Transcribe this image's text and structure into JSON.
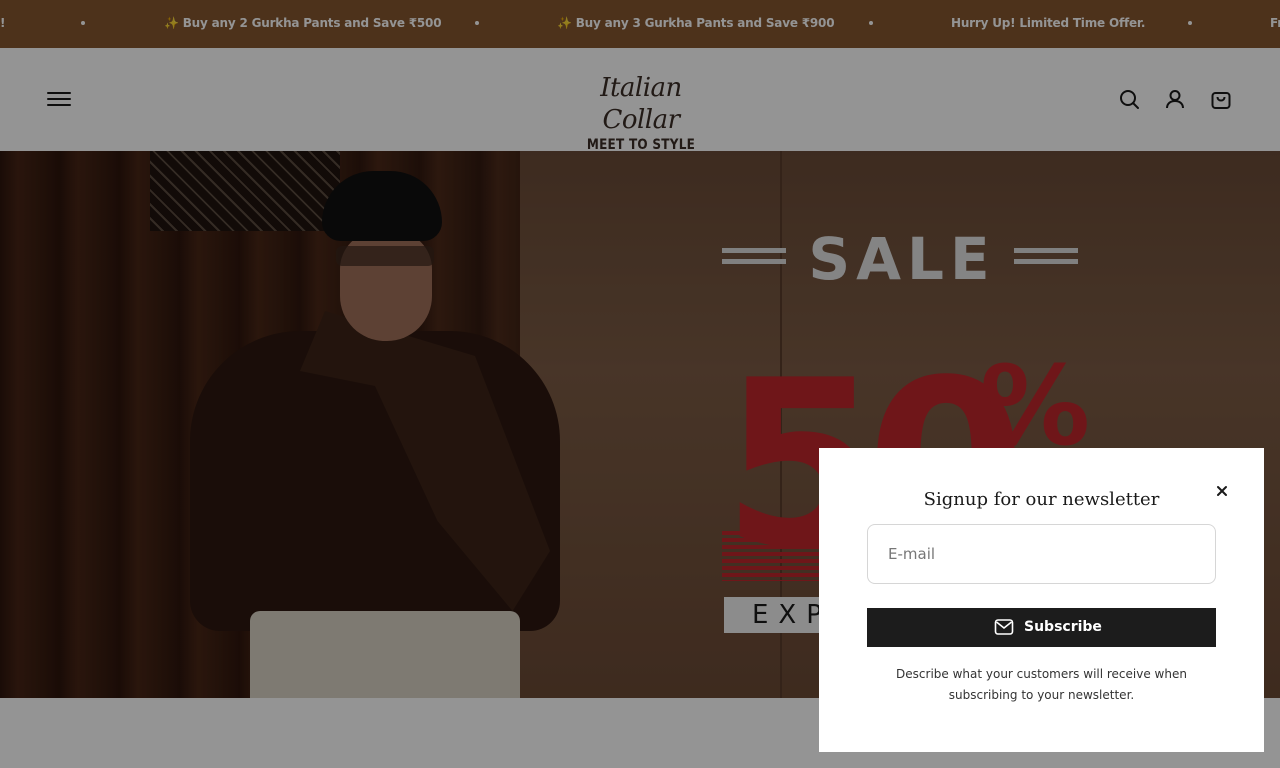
{
  "announcement": {
    "messages": [
      "!",
      "✨ Buy any 2 Gurkha Pants and Save ₹500",
      "✨ Buy any 3 Gurkha Pants and Save ₹900",
      "Hurry Up! Limited Time Offer.",
      "Fr"
    ],
    "background": "#85562f"
  },
  "header": {
    "logo_script": "Italian Collar",
    "logo_tagline": "MEET TO STYLE",
    "icons": [
      "menu-icon",
      "search-icon",
      "account-icon",
      "cart-icon"
    ]
  },
  "hero": {
    "sale_word": "SALE",
    "discount": "50",
    "percent_sign": "%",
    "band_text": "EXP",
    "accent_color": "#c0262c"
  },
  "newsletter": {
    "title": "Signup for our newsletter",
    "email_placeholder": "E-mail",
    "subscribe_label": "Subscribe",
    "description": "Describe what your customers will receive when subscribing to your newsletter.",
    "close_icon": "close-icon",
    "mail_icon": "mail-icon"
  }
}
